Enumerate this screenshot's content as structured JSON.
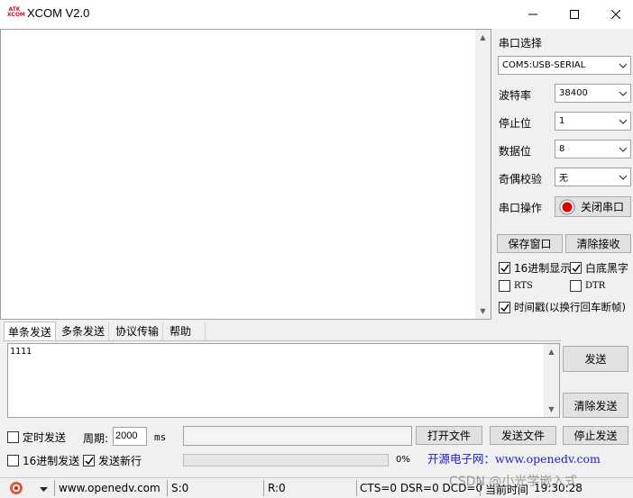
{
  "window": {
    "title": "XCOM V2.0",
    "icon_text_top": "ATK",
    "icon_text_bottom": "XCOM"
  },
  "receive": {
    "text": ""
  },
  "serial": {
    "port_label": "串口选择",
    "port_value": "COM5:USB-SERIAL",
    "baud_label": "波特率",
    "baud_value": "38400",
    "stop_label": "停止位",
    "stop_value": "1",
    "data_label": "数据位",
    "data_value": "8",
    "parity_label": "奇偶校验",
    "parity_value": "无",
    "op_label": "串口操作",
    "close_port_label": "关闭串口",
    "led_color": "#e00000"
  },
  "recv_options": {
    "save_window_label": "保存窗口",
    "clear_recv_label": "清除接收",
    "hex_display_label": "16进制显示",
    "hex_display_checked": true,
    "white_bg_label": "白底黑字",
    "white_bg_checked": true,
    "rts_label": "RTS",
    "rts_checked": false,
    "dtr_label": "DTR",
    "dtr_checked": false,
    "timestamp_label": "时间戳(以换行回车断帧)",
    "timestamp_checked": true
  },
  "tabs": [
    "单条发送",
    "多条发送",
    "协议传输",
    "帮助"
  ],
  "send": {
    "text": "1111",
    "send_label": "发送",
    "clear_send_label": "清除发送",
    "timed_send_label": "定时发送",
    "timed_send_checked": false,
    "period_label": "周期:",
    "period_value": "2000",
    "period_unit": "ms",
    "open_file_label": "打开文件",
    "send_file_label": "发送文件",
    "stop_send_label": "停止发送",
    "hex_send_label": "16进制发送",
    "hex_send_checked": false,
    "newline_label": "发送新行",
    "newline_checked": true,
    "progress_text": "0%",
    "progress": 0,
    "promo": "开源电子网：www.openedv.com"
  },
  "status": {
    "url": "www.openedv.com",
    "sent": "S:0",
    "received": "R:0",
    "lines": "CTS=0 DSR=0 DCD=0",
    "time_label": "当前时间",
    "time_value": "19:30:28",
    "watermark": "CSDN @小光学嵌入式"
  }
}
